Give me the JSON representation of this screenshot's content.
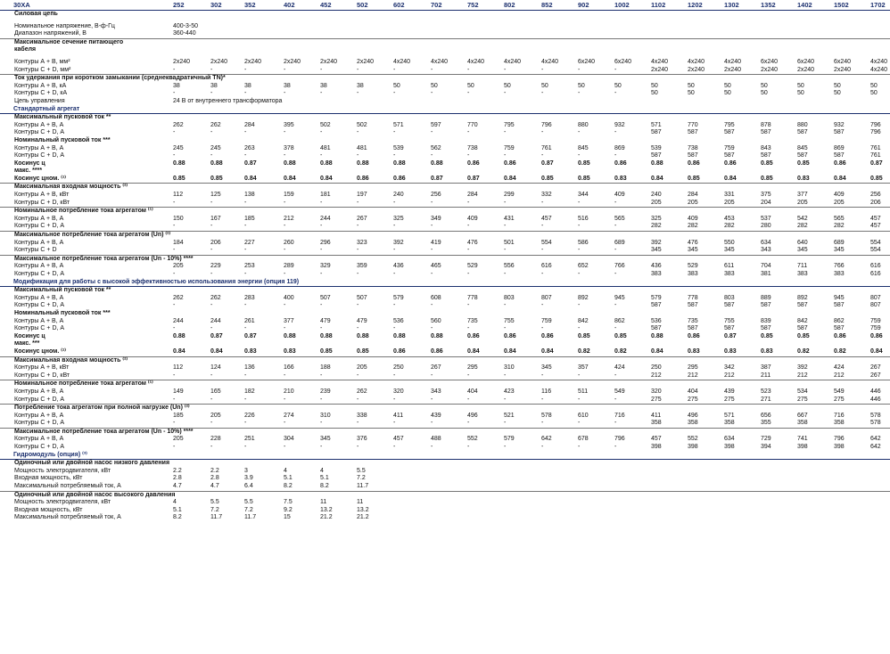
{
  "table": {
    "header": {
      "model": "30XA",
      "columns": [
        "252",
        "302",
        "352",
        "402",
        "452",
        "502",
        "602",
        "702",
        "752",
        "802",
        "852",
        "902",
        "1002",
        "1102",
        "1202",
        "1302",
        "1352",
        "1402",
        "1502",
        "1702"
      ]
    },
    "rows": [
      {
        "type": "sub",
        "label": "Силовая цепь",
        "cells": []
      },
      {
        "type": "blank"
      },
      {
        "type": "data",
        "label": "Номинальное напряжение, В-ф-Гц",
        "cells": [
          "400-3-50"
        ]
      },
      {
        "type": "data",
        "label": "Диапазон напряжений, В",
        "cells": [
          "360-440"
        ]
      },
      {
        "type": "sub",
        "topline": true,
        "label": "Максимальное сечение питающего",
        "cells": []
      },
      {
        "type": "sub",
        "label": "кабеля",
        "cells": []
      },
      {
        "type": "blank"
      },
      {
        "type": "data",
        "label": "Контуры А + В, мм²",
        "cells": [
          "2x240",
          "2x240",
          "2x240",
          "2x240",
          "2x240",
          "2x240",
          "4x240",
          "4x240",
          "4x240",
          "4x240",
          "4x240",
          "6x240",
          "6x240",
          "4x240",
          "4x240",
          "4x240",
          "6x240",
          "6x240",
          "6x240",
          "4x240"
        ]
      },
      {
        "type": "data",
        "label": "Контуры С + D, мм²",
        "cells": [
          "-",
          "-",
          "-",
          "-",
          "-",
          "-",
          "-",
          "-",
          "-",
          "-",
          "-",
          "-",
          "-",
          "2x240",
          "2x240",
          "2x240",
          "2x240",
          "2x240",
          "2x240",
          "4x240"
        ]
      },
      {
        "type": "sub",
        "topline": true,
        "label": "Ток удержания при коротком  замыкании (среднеквадратичный TN)*",
        "cells": []
      },
      {
        "type": "data",
        "label": "Контуры А + В, кА",
        "cells": [
          "38",
          "38",
          "38",
          "38",
          "38",
          "38",
          "50",
          "50",
          "50",
          "50",
          "50",
          "50",
          "50",
          "50",
          "50",
          "50",
          "50",
          "50",
          "50",
          "50"
        ]
      },
      {
        "type": "data",
        "label": "Контуры С + D, кА",
        "cells": [
          "-",
          "-",
          "-",
          "-",
          "-",
          "-",
          "-",
          "-",
          "-",
          "-",
          "-",
          "-",
          "-",
          "50",
          "50",
          "50",
          "50",
          "50",
          "50",
          "50"
        ]
      },
      {
        "type": "data",
        "label": "Цепь управления",
        "cells": [
          "24 В от внутреннего трансформатора"
        ]
      },
      {
        "type": "section",
        "label": "Стандартный агрегат",
        "cells": []
      },
      {
        "type": "sub",
        "label": "Максимальный пусковой ток **",
        "cells": []
      },
      {
        "type": "data",
        "label": "Контуры А + В, А",
        "cells": [
          "262",
          "262",
          "284",
          "395",
          "502",
          "502",
          "571",
          "597",
          "770",
          "795",
          "796",
          "880",
          "932",
          "571",
          "770",
          "795",
          "878",
          "880",
          "932",
          "796"
        ]
      },
      {
        "type": "data",
        "label": "Контуры С + D, А",
        "cells": [
          "-",
          "-",
          "-",
          "-",
          "-",
          "-",
          "-",
          "-",
          "-",
          "-",
          "-",
          "-",
          "-",
          "587",
          "587",
          "587",
          "587",
          "587",
          "587",
          "796"
        ]
      },
      {
        "type": "sub",
        "label": "Номинальный пусковой ток ***",
        "cells": []
      },
      {
        "type": "data",
        "label": "Контуры А + В, А",
        "cells": [
          "245",
          "245",
          "263",
          "378",
          "481",
          "481",
          "539",
          "562",
          "738",
          "759",
          "761",
          "845",
          "869",
          "539",
          "738",
          "759",
          "843",
          "845",
          "869",
          "761"
        ]
      },
      {
        "type": "data",
        "label": "Контуры С + D, А",
        "cells": [
          "-",
          "-",
          "-",
          "-",
          "-",
          "-",
          "-",
          "-",
          "-",
          "-",
          "-",
          "-",
          "-",
          "587",
          "587",
          "587",
          "587",
          "587",
          "587",
          "761"
        ]
      },
      {
        "type": "data",
        "bold": true,
        "label": "Косинус ц",
        "cells": [
          "0.88",
          "0.88",
          "0.87",
          "0.88",
          "0.88",
          "0.88",
          "0.88",
          "0.88",
          "0.86",
          "0.86",
          "0.87",
          "0.85",
          "0.86",
          "0.88",
          "0.86",
          "0.86",
          "0.85",
          "0.85",
          "0.86",
          "0.87"
        ]
      },
      {
        "type": "data",
        "bold": true,
        "label": "макс. ****",
        "cells": []
      },
      {
        "type": "data",
        "bold": true,
        "label": "Косинус цном. ⁽¹⁾",
        "cells": [
          "0.85",
          "0.85",
          "0.84",
          "0.84",
          "0.84",
          "0.86",
          "0.86",
          "0.87",
          "0.87",
          "0.84",
          "0.85",
          "0.85",
          "0.83",
          "0.84",
          "0.85",
          "0.84",
          "0.85",
          "0.83",
          "0.84",
          "0.85"
        ]
      },
      {
        "type": "sub",
        "topline": true,
        "label": "Максимальная входная мощность ⁽²⁾",
        "cells": []
      },
      {
        "type": "data",
        "label": "Контуры А + В, кВт",
        "cells": [
          "112",
          "125",
          "138",
          "159",
          "181",
          "197",
          "240",
          "256",
          "284",
          "299",
          "332",
          "344",
          "409",
          "240",
          "284",
          "331",
          "375",
          "377",
          "409",
          "256"
        ]
      },
      {
        "type": "data",
        "label": "Контуры С + D, кВт",
        "cells": [
          "-",
          "-",
          "-",
          "-",
          "-",
          "-",
          "-",
          "-",
          "-",
          "-",
          "-",
          "-",
          "-",
          "205",
          "205",
          "205",
          "204",
          "205",
          "205",
          "206"
        ]
      },
      {
        "type": "sub",
        "topline": true,
        "label": "Номинальное потребление тока агрегатом ⁽¹⁾",
        "cells": []
      },
      {
        "type": "data",
        "label": "Контуры А + В, А",
        "cells": [
          "150",
          "167",
          "185",
          "212",
          "244",
          "267",
          "325",
          "349",
          "409",
          "431",
          "457",
          "516",
          "565",
          "325",
          "409",
          "453",
          "537",
          "542",
          "565",
          "457"
        ]
      },
      {
        "type": "data",
        "label": "Контуры С + D, А",
        "cells": [
          "-",
          "-",
          "-",
          "-",
          "-",
          "-",
          "-",
          "-",
          "-",
          "-",
          "-",
          "-",
          "-",
          "282",
          "282",
          "282",
          "280",
          "282",
          "282",
          "457"
        ]
      },
      {
        "type": "sub",
        "topline": true,
        "label": "Максимальное потребление тока агрегатом (Un) ⁽²⁾",
        "cells": []
      },
      {
        "type": "data",
        "label": "Контуры А + В, А",
        "cells": [
          "184",
          "206",
          "227",
          "260",
          "296",
          "323",
          "392",
          "419",
          "476",
          "501",
          "554",
          "586",
          "689",
          "392",
          "476",
          "550",
          "634",
          "640",
          "689",
          "554"
        ]
      },
      {
        "type": "data",
        "label": "Контуры С + D",
        "cells": [
          "-",
          "-",
          "-",
          "-",
          "-",
          "-",
          "-",
          "-",
          "-",
          "-",
          "-",
          "-",
          "-",
          "345",
          "345",
          "345",
          "343",
          "345",
          "345",
          "554"
        ]
      },
      {
        "type": "sub",
        "topline": true,
        "label": "Максимальное потребление тока агрегатом (Un - 10%) ****",
        "cells": []
      },
      {
        "type": "data",
        "label": "Контуры А + В, А",
        "cells": [
          "205",
          "229",
          "253",
          "289",
          "329",
          "359",
          "436",
          "465",
          "529",
          "556",
          "616",
          "652",
          "766",
          "436",
          "529",
          "611",
          "704",
          "711",
          "766",
          "616"
        ]
      },
      {
        "type": "data",
        "label": "Контуры С + D, А",
        "cells": [
          "-",
          "-",
          "-",
          "-",
          "-",
          "-",
          "-",
          "-",
          "-",
          "-",
          "-",
          "-",
          "-",
          "383",
          "383",
          "383",
          "381",
          "383",
          "383",
          "616"
        ]
      },
      {
        "type": "section",
        "label": "Модификация для работы с высокой эффективностью использования энергии (опция 119)",
        "cells": []
      },
      {
        "type": "sub",
        "label": "Максимальный пусковой ток **",
        "cells": []
      },
      {
        "type": "data",
        "label": "Контуры А + В, А",
        "cells": [
          "262",
          "262",
          "283",
          "400",
          "507",
          "507",
          "579",
          "608",
          "778",
          "803",
          "807",
          "892",
          "945",
          "579",
          "778",
          "803",
          "889",
          "892",
          "945",
          "807"
        ]
      },
      {
        "type": "data",
        "label": "Контуры С + D, А",
        "cells": [
          "-",
          "-",
          "-",
          "-",
          "-",
          "-",
          "-",
          "-",
          "-",
          "-",
          "-",
          "-",
          "-",
          "587",
          "587",
          "587",
          "587",
          "587",
          "587",
          "807"
        ]
      },
      {
        "type": "sub",
        "label": "Номинальный пусковой ток ***",
        "cells": []
      },
      {
        "type": "data",
        "label": "Контуры А + В, А",
        "cells": [
          "244",
          "244",
          "261",
          "377",
          "479",
          "479",
          "536",
          "560",
          "735",
          "755",
          "759",
          "842",
          "862",
          "536",
          "735",
          "755",
          "839",
          "842",
          "862",
          "759"
        ]
      },
      {
        "type": "data",
        "label": "Контуры С + D, А",
        "cells": [
          "-",
          "-",
          "-",
          "-",
          "-",
          "-",
          "-",
          "-",
          "-",
          "-",
          "-",
          "-",
          "-",
          "587",
          "587",
          "587",
          "587",
          "587",
          "587",
          "759"
        ]
      },
      {
        "type": "data",
        "bold": true,
        "topline": true,
        "label": "Косинус ц",
        "cells": [
          "0.88",
          "0.87",
          "0.87",
          "0.88",
          "0.88",
          "0.88",
          "0.88",
          "0.88",
          "0.86",
          "0.86",
          "0.86",
          "0.85",
          "0.85",
          "0.88",
          "0.86",
          "0.87",
          "0.85",
          "0.85",
          "0.86",
          "0.86"
        ]
      },
      {
        "type": "data",
        "bold": true,
        "label": "макс. ***",
        "cells": []
      },
      {
        "type": "data",
        "bold": true,
        "label": "Косинус цном. ⁽¹⁾",
        "cells": [
          "0.84",
          "0.84",
          "0.83",
          "0.83",
          "0.85",
          "0.85",
          "0.86",
          "0.86",
          "0.84",
          "0.84",
          "0.84",
          "0.82",
          "0.82",
          "0.84",
          "0.83",
          "0.83",
          "0.83",
          "0.82",
          "0.82",
          "0.84"
        ]
      },
      {
        "type": "sub",
        "topline": true,
        "label": "Максимальная входная мощность ⁽²⁾",
        "cells": []
      },
      {
        "type": "data",
        "label": "Контуры А + В, кВт",
        "cells": [
          "112",
          "124",
          "136",
          "166",
          "188",
          "205",
          "250",
          "267",
          "295",
          "310",
          "345",
          "357",
          "424",
          "250",
          "295",
          "342",
          "387",
          "392",
          "424",
          "267"
        ]
      },
      {
        "type": "data",
        "label": "Контуры С + D, кВт",
        "cells": [
          "-",
          "-",
          "-",
          "-",
          "-",
          "-",
          "-",
          "-",
          "-",
          "-",
          "-",
          "-",
          "-",
          "212",
          "212",
          "212",
          "211",
          "212",
          "212",
          "267"
        ]
      },
      {
        "type": "sub",
        "topline": true,
        "label": "Номинальное потребление тока агрегатом ⁽¹⁾",
        "cells": []
      },
      {
        "type": "data",
        "label": "Контуры А + В, А",
        "cells": [
          "149",
          "165",
          "182",
          "210",
          "239",
          "262",
          "320",
          "343",
          "404",
          "423",
          "116",
          "511",
          "549",
          "320",
          "404",
          "439",
          "523",
          "534",
          "549",
          "446"
        ]
      },
      {
        "type": "data",
        "label": "Контуры С + D, А",
        "cells": [
          "-",
          "-",
          "-",
          "-",
          "-",
          "-",
          "-",
          "-",
          "-",
          "-",
          "-",
          "-",
          "-",
          "275",
          "275",
          "275",
          "271",
          "275",
          "275",
          "446"
        ]
      },
      {
        "type": "sub",
        "topline": true,
        "label": "Потребление тока агрегатом при полной нагрузке (Un) ⁽²⁾",
        "cells": []
      },
      {
        "type": "data",
        "label": "Контуры А + В, А",
        "cells": [
          "185",
          "205",
          "226",
          "274",
          "310",
          "338",
          "411",
          "439",
          "496",
          "521",
          "578",
          "610",
          "716",
          "411",
          "496",
          "571",
          "656",
          "667",
          "716",
          "578"
        ]
      },
      {
        "type": "data",
        "label": "Контуры С + D, А",
        "cells": [
          "-",
          "-",
          "-",
          "-",
          "-",
          "-",
          "-",
          "-",
          "-",
          "-",
          "-",
          "-",
          "-",
          "358",
          "358",
          "358",
          "355",
          "358",
          "358",
          "578"
        ]
      },
      {
        "type": "sub",
        "topline": true,
        "label": "Максимальное потребление тока агрегатом (Un - 10%) ****",
        "cells": []
      },
      {
        "type": "data",
        "label": "Контуры А + В, А",
        "cells": [
          "205",
          "228",
          "251",
          "304",
          "345",
          "376",
          "457",
          "488",
          "552",
          "579",
          "642",
          "678",
          "796",
          "457",
          "552",
          "634",
          "729",
          "741",
          "796",
          "642"
        ]
      },
      {
        "type": "data",
        "label": "Контуры С + D, А",
        "cells": [
          "-",
          "-",
          "-",
          "-",
          "-",
          "-",
          "-",
          "-",
          "-",
          "-",
          "-",
          "-",
          "-",
          "398",
          "398",
          "398",
          "394",
          "398",
          "398",
          "642"
        ]
      },
      {
        "type": "section",
        "label": "Гидромодуль (опция) ⁽³⁾",
        "cells": []
      },
      {
        "type": "sub",
        "label": "Одиночный или двойной насос низкого давления",
        "cells": []
      },
      {
        "type": "data",
        "label": "Мощность электродвигателя, кВт",
        "cells": [
          "2.2",
          "2.2",
          "3",
          "4",
          "4",
          "5.5"
        ]
      },
      {
        "type": "data",
        "label": "Входная мощность, кВт",
        "cells": [
          "2.8",
          "2.8",
          "3.9",
          "5.1",
          "5.1",
          "7.2"
        ]
      },
      {
        "type": "data",
        "label": "Максимальный потребляемый ток, А",
        "cells": [
          "4.7",
          "4.7",
          "6.4",
          "8.2",
          "8.2",
          "11.7"
        ]
      },
      {
        "type": "sub",
        "topline": true,
        "label": "Одиночный или двойной насос высокого давления",
        "cells": []
      },
      {
        "type": "data",
        "label": "Мощность электродвигателя, кВт",
        "cells": [
          "4",
          "5.5",
          "5.5",
          "7.5",
          "11",
          "11"
        ]
      },
      {
        "type": "data",
        "label": "Входная мощность, кВт",
        "cells": [
          "5.1",
          "7.2",
          "7.2",
          "9.2",
          "13.2",
          "13.2"
        ]
      },
      {
        "type": "data",
        "label": "Максимальный потребляемый ток, А",
        "cells": [
          "8.2",
          "11.7",
          "11.7",
          "15",
          "21.2",
          "21.2"
        ]
      }
    ]
  }
}
